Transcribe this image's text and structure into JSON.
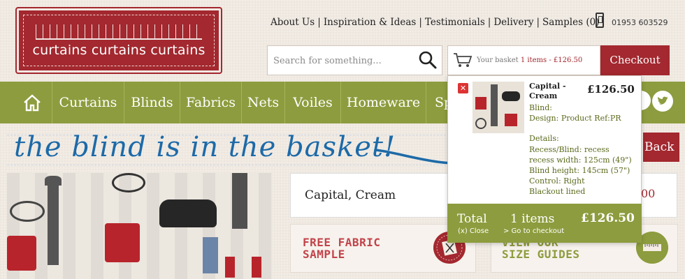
{
  "brand": {
    "logo_text": "curtains curtains curtains"
  },
  "top_nav": {
    "links": [
      "About Us",
      "Inspiration & Ideas",
      "Testimonials",
      "Delivery",
      "Samples (0)"
    ],
    "phone": "01953 603529"
  },
  "search": {
    "placeholder": "Search for something..."
  },
  "basket": {
    "label": "Your basket",
    "summary": "1 items - £126.50",
    "checkout_label": "Checkout"
  },
  "main_nav": {
    "items": [
      "Curtains",
      "Blinds",
      "Fabrics",
      "Nets",
      "Voiles",
      "Homeware",
      "Sp"
    ]
  },
  "annotation": {
    "text": "the blind is in the basket!"
  },
  "back_button": {
    "label": "Back"
  },
  "product": {
    "title": "Capital, Cream",
    "price_fragment": "00"
  },
  "promos": {
    "free_sample": [
      "FREE FABRIC",
      "SAMPLE"
    ],
    "size_guides": [
      "VIEW OUR",
      "SIZE GUIDES"
    ]
  },
  "dropdown": {
    "remove_label": "✕",
    "item_name": "Capital - Cream",
    "item_price": "£126.50",
    "item_type": "Blind:",
    "item_design": "Design: Product Ref:PR",
    "details_heading": "Details:",
    "details": [
      "Recess/Blind: recess",
      "recess width: 125cm (49\")",
      "Blind height: 145cm (57\")",
      "Control: Right",
      "Blackout lined"
    ],
    "footer": {
      "total_label": "Total",
      "close_label": "(x) Close",
      "count": "1 items",
      "goto_label": "> Go to checkout",
      "total_price": "£126.50"
    }
  },
  "colors": {
    "brand_red": "#a3282f",
    "nav_green": "#8d9c3e",
    "annotation_blue": "#1d6aa8"
  }
}
